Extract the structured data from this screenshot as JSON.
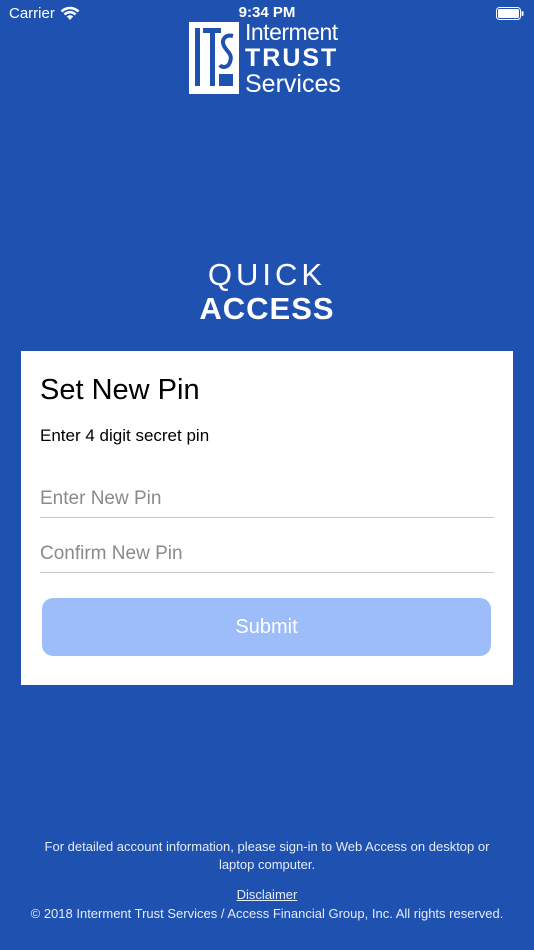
{
  "status_bar": {
    "carrier": "Carrier",
    "time": "9:34 PM"
  },
  "logo": {
    "line1": "Interment",
    "line2": "TRUST",
    "line3": "Services"
  },
  "quick_access": {
    "line1": "QUICK",
    "line2": "ACCESS"
  },
  "card": {
    "title": "Set New Pin",
    "subtitle": "Enter 4 digit secret pin",
    "new_pin_placeholder": "Enter New Pin",
    "confirm_pin_placeholder": "Confirm New Pin",
    "submit_label": "Submit"
  },
  "footer": {
    "info": "For detailed account information, please sign-in to Web Access on desktop or laptop computer.",
    "disclaimer": "Disclaimer",
    "copyright": "© 2018 Interment Trust Services / Access Financial Group, Inc. All rights reserved."
  },
  "colors": {
    "background": "#1f52b0",
    "card": "#ffffff",
    "button": "#9cbcfa"
  }
}
